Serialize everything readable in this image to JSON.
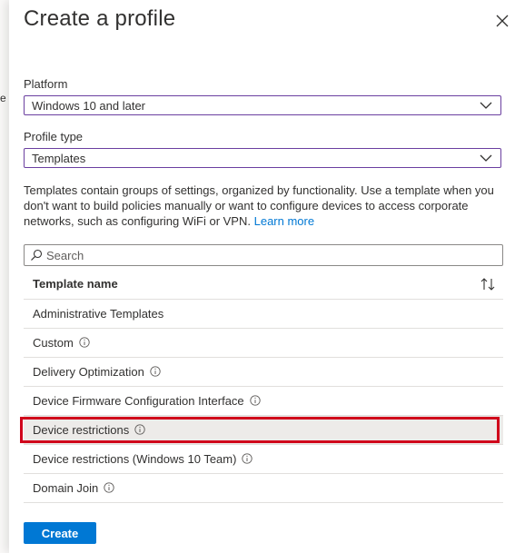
{
  "backdrop": {
    "fragment": "e"
  },
  "panel": {
    "title": "Create a profile",
    "close_icon": "close-icon"
  },
  "platform": {
    "label": "Platform",
    "value": "Windows 10 and later"
  },
  "profile_type": {
    "label": "Profile type",
    "value": "Templates"
  },
  "description": {
    "text": "Templates contain groups of settings, organized by functionality. Use a template when you don't want to build policies manually or want to configure devices to access corporate networks, such as configuring WiFi or VPN.",
    "link": "Learn more"
  },
  "search": {
    "placeholder": "Search",
    "value": ""
  },
  "table": {
    "header": "Template name",
    "rows": [
      {
        "name": "Administrative Templates",
        "info": false,
        "selected": false
      },
      {
        "name": "Custom",
        "info": true,
        "selected": false
      },
      {
        "name": "Delivery Optimization",
        "info": true,
        "selected": false
      },
      {
        "name": "Device Firmware Configuration Interface",
        "info": true,
        "selected": false
      },
      {
        "name": "Device restrictions",
        "info": true,
        "selected": true
      },
      {
        "name": "Device restrictions (Windows 10 Team)",
        "info": true,
        "selected": false
      },
      {
        "name": "Domain Join",
        "info": true,
        "selected": false
      }
    ]
  },
  "actions": {
    "create_label": "Create"
  },
  "colors": {
    "accent": "#0078d4",
    "select_border": "#6b3fa0",
    "highlight_border": "#d0021b",
    "selected_row": "#edebe9"
  }
}
